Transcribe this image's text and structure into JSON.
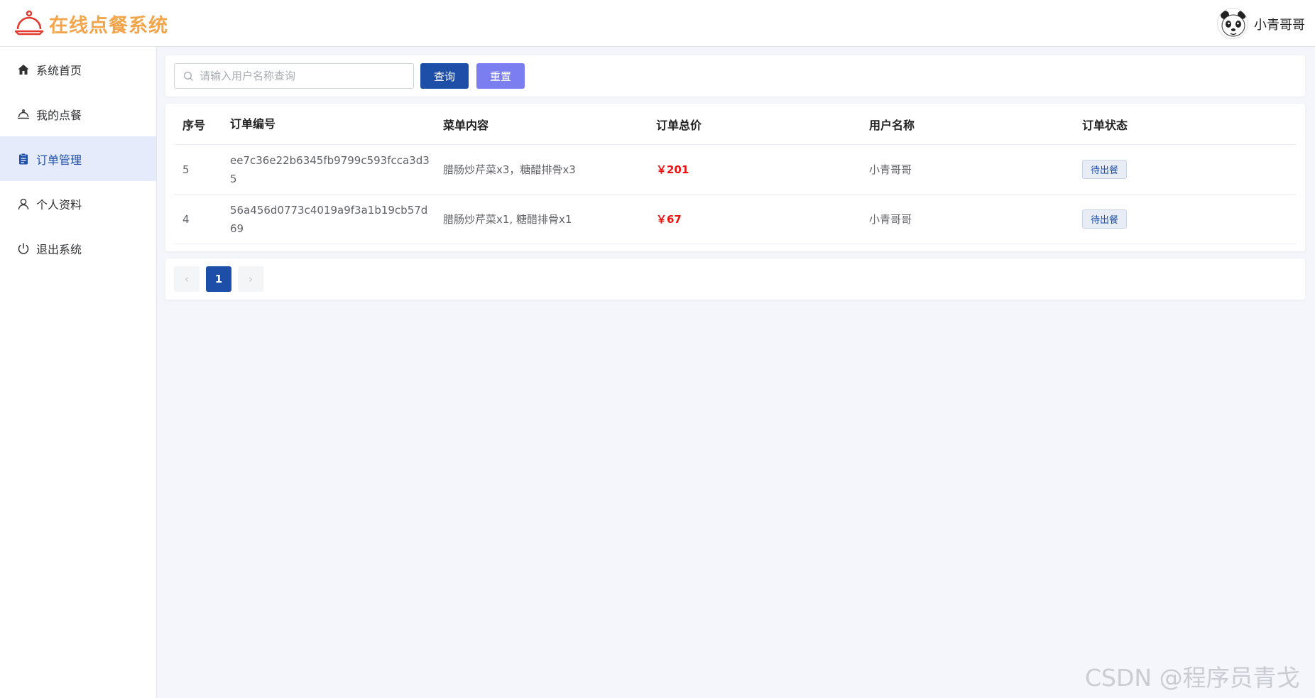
{
  "app": {
    "title": "在线点餐系统"
  },
  "user": {
    "name": "小青哥哥"
  },
  "sidebar": {
    "items": [
      {
        "label": "系统首页",
        "icon": "home-icon"
      },
      {
        "label": "我的点餐",
        "icon": "dining-bell-icon"
      },
      {
        "label": "订单管理",
        "icon": "clipboard-icon"
      },
      {
        "label": "个人资料",
        "icon": "user-icon"
      },
      {
        "label": "退出系统",
        "icon": "power-icon"
      }
    ],
    "active_index": 2
  },
  "search": {
    "placeholder": "请输入用户名称查询",
    "value": "",
    "query_label": "查询",
    "reset_label": "重置"
  },
  "table": {
    "headers": [
      "序号",
      "订单编号",
      "菜单内容",
      "订单总价",
      "用户名称",
      "订单状态"
    ],
    "rows": [
      {
        "index": "5",
        "order_no": "ee7c36e22b6345fb9799c593fcca3d35",
        "items": "腊肠炒芹菜x3，糖醋排骨x3",
        "price": "￥201",
        "user": "小青哥哥",
        "status": "待出餐"
      },
      {
        "index": "4",
        "order_no": "56a456d0773c4019a9f3a1b19cb57d69",
        "items": "腊肠炒芹菜x1, 糖醋排骨x1",
        "price": "￥67",
        "user": "小青哥哥",
        "status": "待出餐"
      }
    ]
  },
  "pagination": {
    "current": "1",
    "prev": "‹",
    "next": "›"
  },
  "watermark": "CSDN @程序员青戈",
  "colors": {
    "accent": "#1d4fa8",
    "reset_button": "#7b7ef0",
    "logo": "#f2a54a",
    "price": "#ee1111",
    "active_nav_bg": "#e6ebfb"
  }
}
